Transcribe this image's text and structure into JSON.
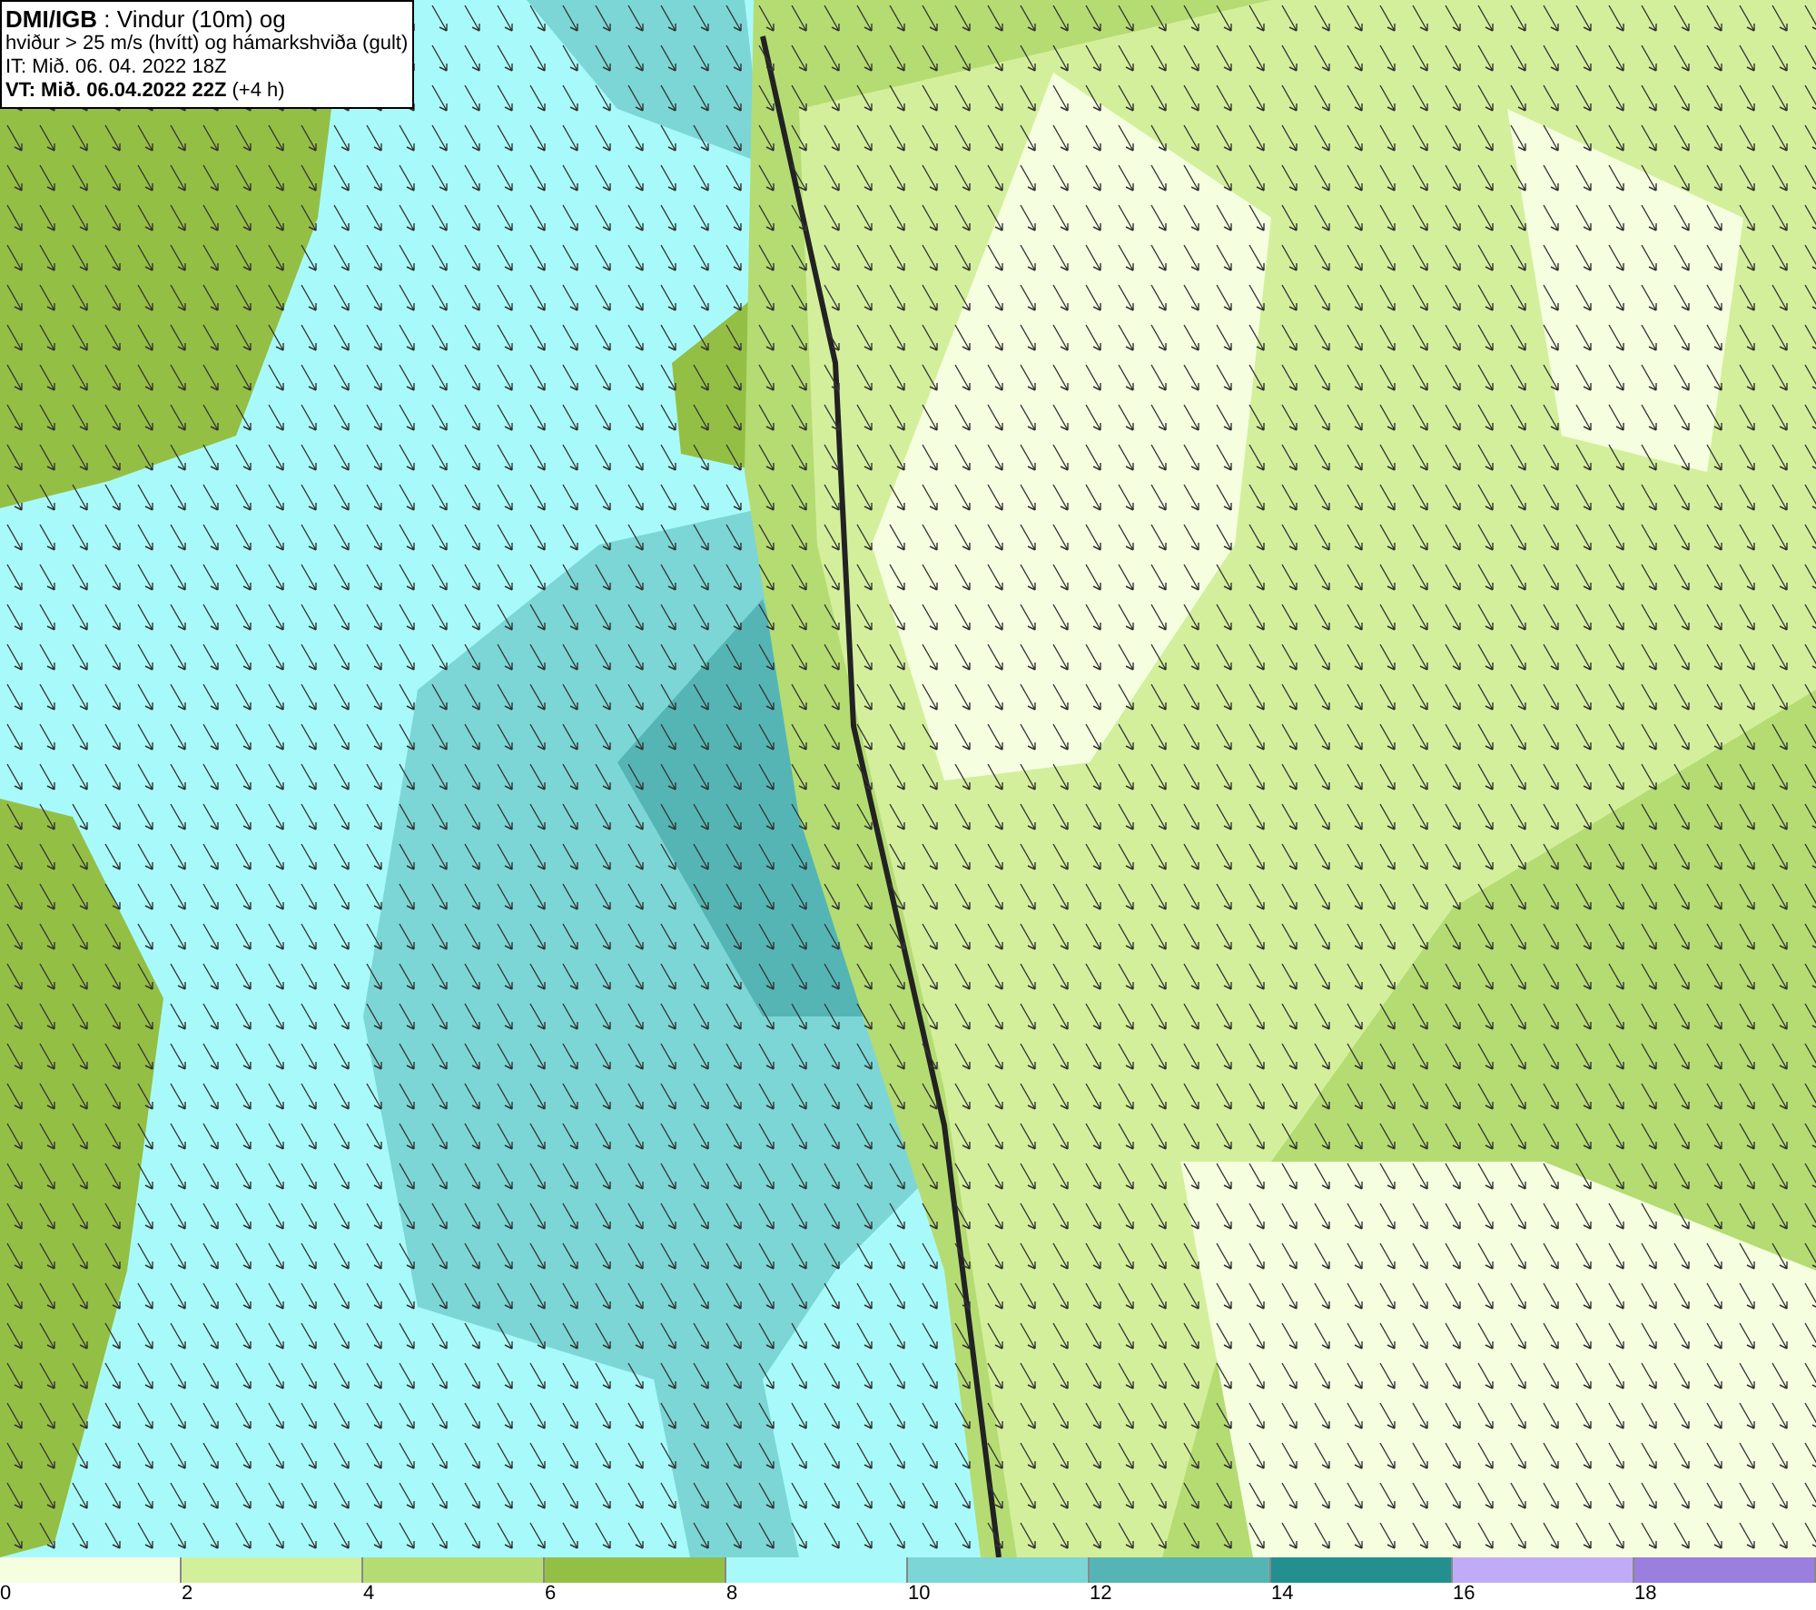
{
  "info_box": {
    "lines": [
      "**DMI/IGB** : Vindur (10m) og",
      "hviður > 25 m/s (hvítt) og hámarkshviða (gult)",
      "IT: Mið. 06. 04. 2022 18Z",
      "**VT: Mið. 06.04.2022 22Z** (+4 h)"
    ]
  },
  "legend": {
    "bins": [
      {
        "label": "0",
        "color": "#f5ffe0"
      },
      {
        "label": "2",
        "color": "#d4ef9c"
      },
      {
        "label": "4",
        "color": "#b5dc72"
      },
      {
        "label": "6",
        "color": "#94bf45"
      },
      {
        "label": "8",
        "color": "#a8fafa"
      },
      {
        "label": "10",
        "color": "#7cd6d6"
      },
      {
        "label": "12",
        "color": "#55b5b5"
      },
      {
        "label": "14",
        "color": "#238f8f"
      },
      {
        "label": "16",
        "color": "#c0acf6"
      },
      {
        "label": "18",
        "color": "#9a7fde"
      }
    ]
  }
}
